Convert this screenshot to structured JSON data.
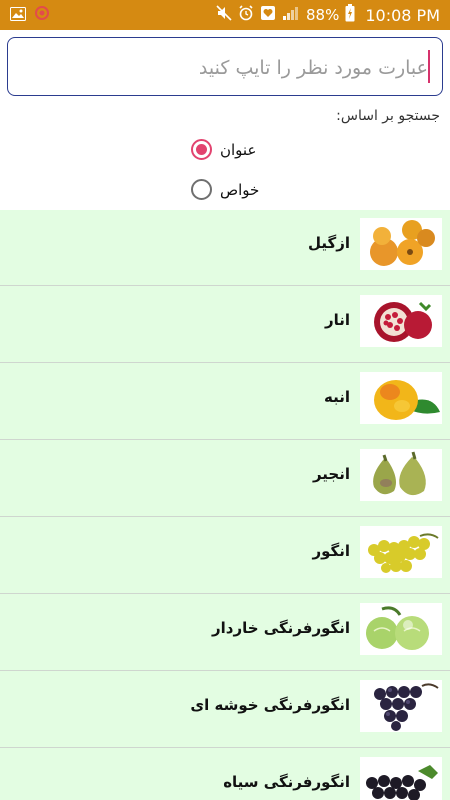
{
  "status_bar": {
    "battery": "88%",
    "time": "10:08 PM",
    "color": "#d58a12"
  },
  "search": {
    "placeholder": "عبارت مورد نظر را تایپ کنید",
    "value": ""
  },
  "filter": {
    "label": "جستجو بر اساس:",
    "options": [
      {
        "label": "عنوان",
        "selected": true
      },
      {
        "label": "خواص",
        "selected": false
      }
    ],
    "accent": "#e2436f"
  },
  "list": {
    "background": "#e3fde2",
    "items": [
      {
        "label": "ازگیل",
        "image": "medlar-fruit-image"
      },
      {
        "label": "انار",
        "image": "pomegranate-image"
      },
      {
        "label": "انبه",
        "image": "mango-image"
      },
      {
        "label": "انجیر",
        "image": "fig-image"
      },
      {
        "label": "انگور",
        "image": "grapes-image"
      },
      {
        "label": "انگورفرنگی خاردار",
        "image": "gooseberry-image"
      },
      {
        "label": "انگورفرنگی خوشه ای",
        "image": "black-grapes-image"
      },
      {
        "label": "انگورفرنگی سیاه",
        "image": "blackcurrant-image"
      }
    ]
  }
}
